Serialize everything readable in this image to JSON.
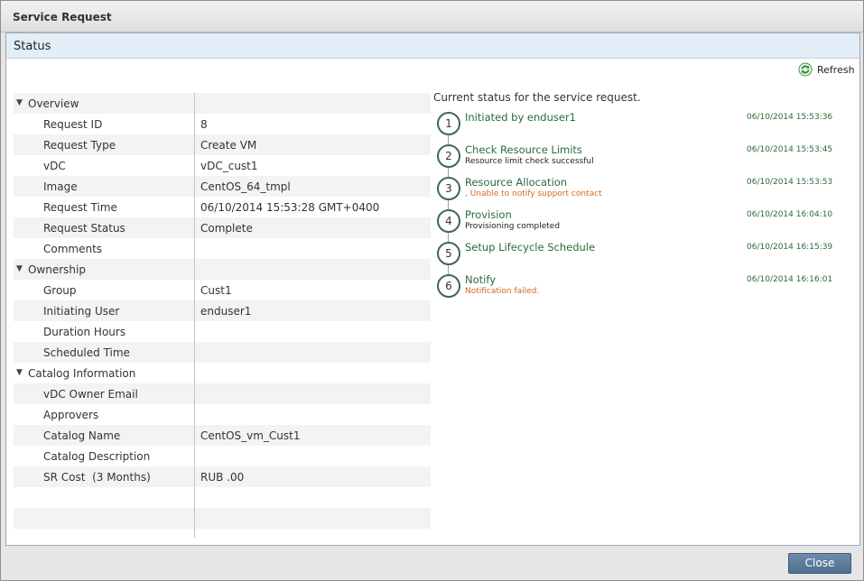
{
  "dialog": {
    "title": "Service Request"
  },
  "panel": {
    "title": "Status",
    "refresh_label": "Refresh"
  },
  "details": {
    "rows": [
      {
        "type": "section",
        "label": "Overview"
      },
      {
        "type": "field",
        "label": "Request ID",
        "value": "8"
      },
      {
        "type": "field",
        "label": "Request Type",
        "value": "Create VM"
      },
      {
        "type": "field",
        "label": "vDC",
        "value": "vDC_cust1"
      },
      {
        "type": "field",
        "label": "Image",
        "value": "CentOS_64_tmpl"
      },
      {
        "type": "field",
        "label": "Request Time",
        "value": "06/10/2014 15:53:28 GMT+0400"
      },
      {
        "type": "field",
        "label": "Request Status",
        "value": "Complete"
      },
      {
        "type": "field",
        "label": "Comments",
        "value": ""
      },
      {
        "type": "section",
        "label": "Ownership"
      },
      {
        "type": "field",
        "label": "Group",
        "value": "Cust1"
      },
      {
        "type": "field",
        "label": "Initiating User",
        "value": "enduser1"
      },
      {
        "type": "field",
        "label": "Duration Hours",
        "value": ""
      },
      {
        "type": "field",
        "label": "Scheduled Time",
        "value": ""
      },
      {
        "type": "section",
        "label": "Catalog Information"
      },
      {
        "type": "field",
        "label": "vDC Owner Email",
        "value": ""
      },
      {
        "type": "field",
        "label": "Approvers",
        "value": ""
      },
      {
        "type": "field",
        "label": "Catalog Name",
        "value": "CentOS_vm_Cust1"
      },
      {
        "type": "field",
        "label": "Catalog Description",
        "value": ""
      },
      {
        "type": "field",
        "label": "SR Cost  (3 Months)",
        "value": "RUB .00"
      },
      {
        "type": "blank",
        "label": "",
        "value": ""
      },
      {
        "type": "blank",
        "label": "",
        "value": ""
      }
    ]
  },
  "status": {
    "caption": "Current status for the service request.",
    "steps": [
      {
        "num": "1",
        "title": "Initiated by enduser1",
        "sub": "",
        "sub_error": false,
        "time": "06/10/2014 15:53:36"
      },
      {
        "num": "2",
        "title": "Check Resource Limits",
        "sub": "Resource limit check successful",
        "sub_error": false,
        "time": "06/10/2014 15:53:45"
      },
      {
        "num": "3",
        "title": "Resource Allocation",
        "sub": ", Unable to notify support contact",
        "sub_error": true,
        "time": "06/10/2014 15:53:53"
      },
      {
        "num": "4",
        "title": "Provision",
        "sub": "Provisioning completed",
        "sub_error": false,
        "time": "06/10/2014 16:04:10"
      },
      {
        "num": "5",
        "title": "Setup Lifecycle Schedule",
        "sub": "",
        "sub_error": false,
        "time": "06/10/2014 16:15:39"
      },
      {
        "num": "6",
        "title": "Notify",
        "sub": "Notification failed.",
        "sub_error": true,
        "time": "06/10/2014 16:16:01"
      }
    ]
  },
  "footer": {
    "close_label": "Close"
  },
  "colors": {
    "accent_green": "#2a6b3a",
    "error_orange": "#d4691d",
    "header_blue": "#e2edf6",
    "button_blue": "#5a7a9c"
  },
  "icons": {
    "refresh": "refresh-icon",
    "collapse": "triangle-down-icon",
    "step": "step-circle-icon"
  }
}
